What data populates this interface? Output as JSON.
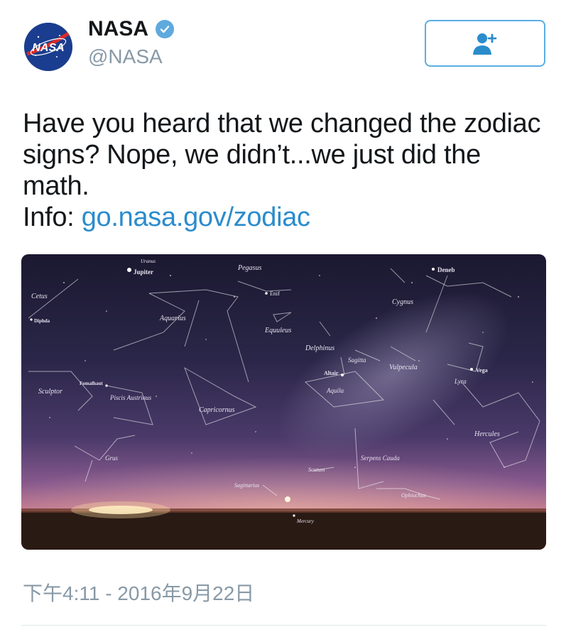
{
  "user": {
    "display_name": "NASA",
    "handle": "@NASA",
    "avatar_text": "NASA",
    "verified_icon": "verified-badge-icon"
  },
  "follow_button": {
    "icon": "add-user-icon"
  },
  "tweet": {
    "line1": "Have you heard that we changed the zodiac",
    "line2": "signs? Nope, we didn’t...we just did the math.",
    "line3_prefix": "Info: ",
    "link": "go.nasa.gov/zodiac",
    "link_color": "#2b8ccc"
  },
  "media": {
    "labels": {
      "jupiter": "Jupiter",
      "uranus": "Uranus",
      "pegasus": "Pegasus",
      "deneb": "Deneb",
      "enif": "Enif",
      "cetus": "Cetus",
      "aquarius": "Aquarius",
      "cygnus": "Cygnus",
      "diphda": "Diphda",
      "equuleus": "Equuleus",
      "delphinus": "Delphinus",
      "sagitta": "Sagitta",
      "vulpecula": "Vulpecula",
      "vega": "Vega",
      "lyra": "Lyra",
      "altair": "Altair",
      "aquila": "Aquila",
      "fomalhaut": "Fomalhaut",
      "sculptor": "Sculptor",
      "piscis_austrinus": "Piscis Austrinus",
      "capricornus": "Capricornus",
      "hercules": "Hercules",
      "grus": "Grus",
      "serpens_cauda": "Serpens Cauda",
      "scutum": "Scutum",
      "sagittarius": "Sagittarius",
      "ophiuchus": "Ophiuchus",
      "mercury": "Mercury"
    }
  },
  "timestamp": "下午4:11 - 2016年9月22日",
  "colors": {
    "verified": "#5ea9dd",
    "follow_border": "#5aaee4",
    "secondary_text": "#8899a6"
  }
}
